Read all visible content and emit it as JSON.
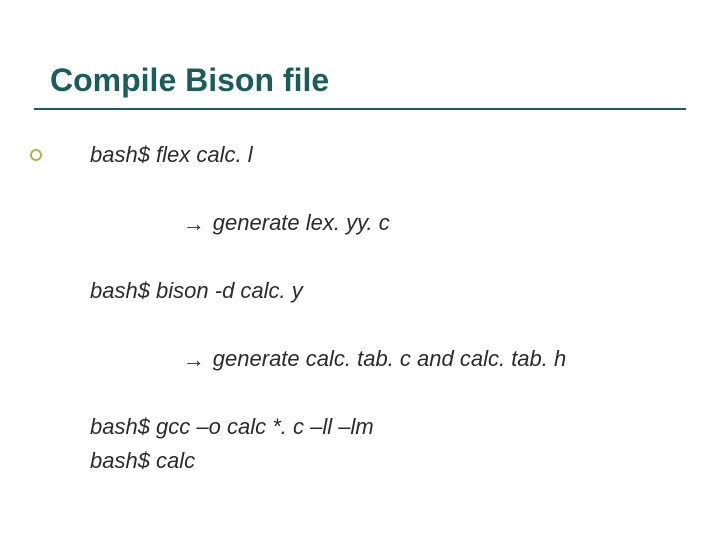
{
  "slide": {
    "title": "Compile Bison file",
    "lines": {
      "l1": "bash$ flex calc. l",
      "l2_arrow": "→",
      "l2_text": " generate lex. yy. c",
      "l3": "bash$ bison -d calc. y",
      "l4_arrow": "→",
      "l4_text": " generate calc. tab. c and calc. tab. h",
      "l5": "bash$ gcc –o calc *. c –ll –lm",
      "l6": "bash$ calc"
    }
  }
}
